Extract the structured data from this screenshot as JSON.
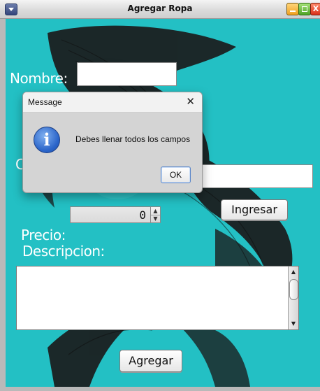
{
  "window": {
    "title": "Agregar Ropa",
    "close_glyph": "X"
  },
  "form": {
    "nombre_label": "Nombre:",
    "nombre_value": "",
    "obscured_label_initial": "C",
    "obscured_field_value": "",
    "precio_label": "Precio:",
    "precio_value": "0",
    "spinner_up": "▲",
    "spinner_down": "▼",
    "ingresar_label": "Ingresar",
    "descripcion_label": "Descripcion:",
    "descripcion_value": "",
    "scroll_up": "▲",
    "scroll_down": "▼",
    "agregar_label": "Agregar"
  },
  "dialog": {
    "title": "Message",
    "close_glyph": "✕",
    "icon_glyph": "i",
    "message": "Debes llenar todos los campos",
    "ok_label": "OK"
  },
  "colors": {
    "background": "#23c0c4",
    "dialog_bg": "#d4d4d4",
    "info_icon": "#2a64c9"
  }
}
